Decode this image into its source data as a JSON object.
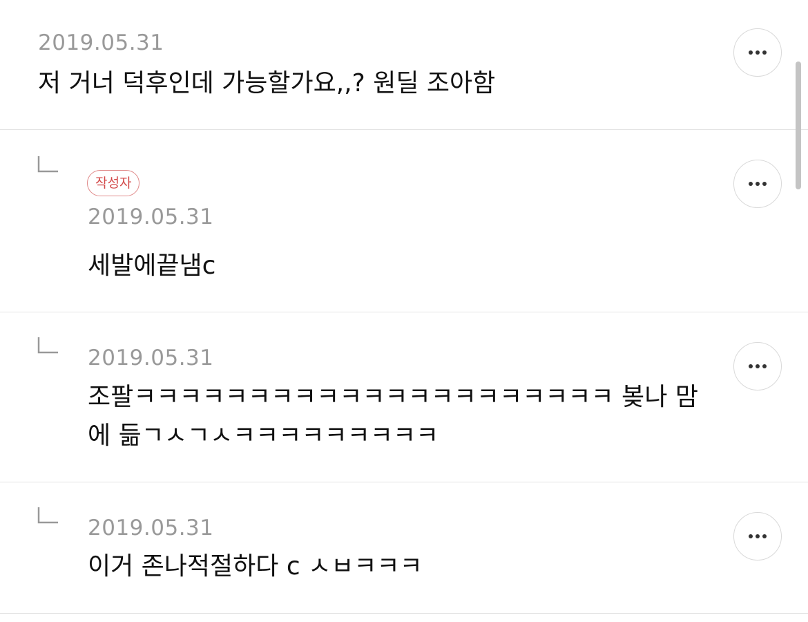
{
  "comments": [
    {
      "date": "2019.05.31",
      "text": "저 거너 덕후인데 가능할가요,,? 원딜 조아함",
      "more_label": "more options"
    },
    {
      "badge": "작성자",
      "date": "2019.05.31",
      "text": "세발에끝냄c",
      "more_label": "more options"
    },
    {
      "date": "2019.05.31",
      "text_line1": "조팔ㅋㅋㅋㅋㅋㅋㅋㅋㅋㅋㅋㅋㅋㅋㅋㅋㅋㅋㅋㅋㅋ 봊나 맘",
      "text_line2": "에 듦ㄱㅅㄱㅅㅋㅋㅋㅋㅋㅋㅋㅋㅋ",
      "more_label": "more options"
    },
    {
      "date": "2019.05.31",
      "text": "이거 존나적절하다 c ㅅㅂㅋㅋㅋ",
      "more_label": "more options"
    }
  ],
  "colors": {
    "date": "#999999",
    "badge_text": "#d34a4a",
    "badge_border": "#e08a8a",
    "divider": "#e3e3e3"
  }
}
